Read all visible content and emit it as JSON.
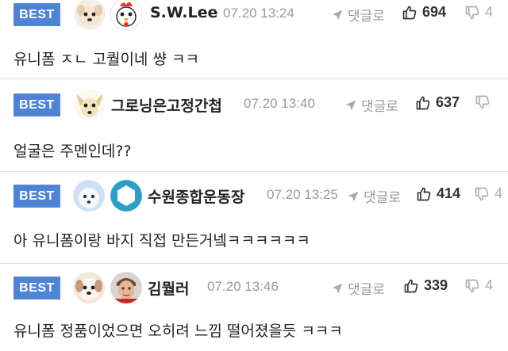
{
  "badge_label": "BEST",
  "reply_label": "댓글로",
  "comments": [
    {
      "nickname": "S.W.Lee",
      "date": "07.20 13:24",
      "likes": "694",
      "dislikes": "4",
      "text": "유니폼 ㅈㄴ 고퀄이네 썅 ㅋㅋ",
      "avatars": [
        "dog-avatar",
        "rooster-avatar"
      ]
    },
    {
      "nickname": "그로닝은고정간첩",
      "date": "07.20 13:40",
      "likes": "637",
      "dislikes": "",
      "text": "얼굴은 주멘인데??",
      "avatars": [
        "chihuahua-avatar"
      ]
    },
    {
      "nickname": "수원종합운동장",
      "date": "07.20 13:25",
      "likes": "414",
      "dislikes": "4",
      "text": "아 유니폼이랑 바지 직접 만든거넼ㅋㅋㅋㅋㅋㅋ",
      "avatars": [
        "white-dog-avatar",
        "hexagon-avatar"
      ]
    },
    {
      "nickname": "김뭘러",
      "date": "07.20 13:46",
      "likes": "339",
      "dislikes": "4",
      "text": "유니폼 정품이었으면 오히려 느낌 떨어졌을듯 ㅋㅋㅋ",
      "avatars": [
        "puppy-avatar",
        "man-face-avatar"
      ]
    }
  ],
  "colors": {
    "badge": "#4f83d4",
    "muted": "#9a9a9a",
    "divider": "#e2e2e2"
  }
}
